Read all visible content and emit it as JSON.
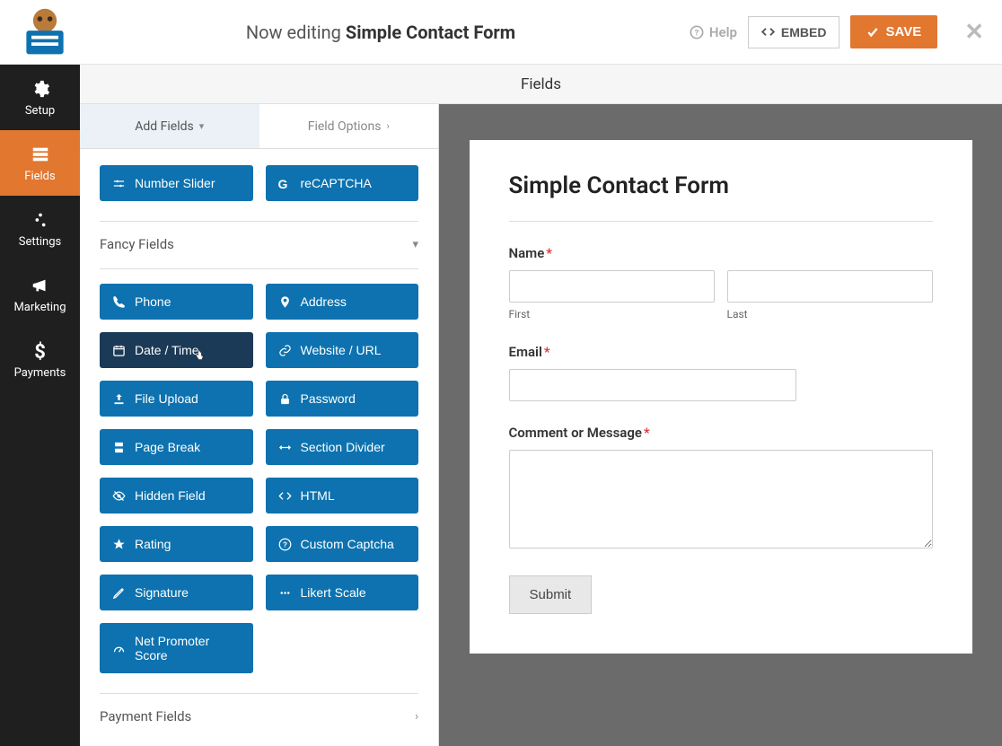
{
  "header": {
    "editing_prefix": "Now editing ",
    "form_name": "Simple Contact Form",
    "help_label": "Help",
    "embed_label": "EMBED",
    "save_label": "SAVE"
  },
  "nav": {
    "setup": "Setup",
    "fields": "Fields",
    "settings": "Settings",
    "marketing": "Marketing",
    "payments": "Payments"
  },
  "subheader": {
    "title": "Fields"
  },
  "sidebar_tabs": {
    "add_fields": "Add Fields",
    "field_options": "Field Options"
  },
  "top_fields": {
    "number_slider": "Number Slider",
    "recaptcha": "reCAPTCHA"
  },
  "sections": {
    "fancy": "Fancy Fields",
    "payment": "Payment Fields"
  },
  "fancy": {
    "phone": "Phone",
    "address": "Address",
    "date_time": "Date / Time",
    "website_url": "Website / URL",
    "file_upload": "File Upload",
    "password": "Password",
    "page_break": "Page Break",
    "section_divider": "Section Divider",
    "hidden_field": "Hidden Field",
    "html": "HTML",
    "rating": "Rating",
    "custom_captcha": "Custom Captcha",
    "signature": "Signature",
    "likert_scale": "Likert Scale",
    "nps": "Net Promoter Score"
  },
  "form": {
    "title": "Simple Contact Form",
    "name_label": "Name",
    "first_sub": "First",
    "last_sub": "Last",
    "email_label": "Email",
    "comment_label": "Comment or Message",
    "submit": "Submit",
    "required_marker": "*"
  }
}
